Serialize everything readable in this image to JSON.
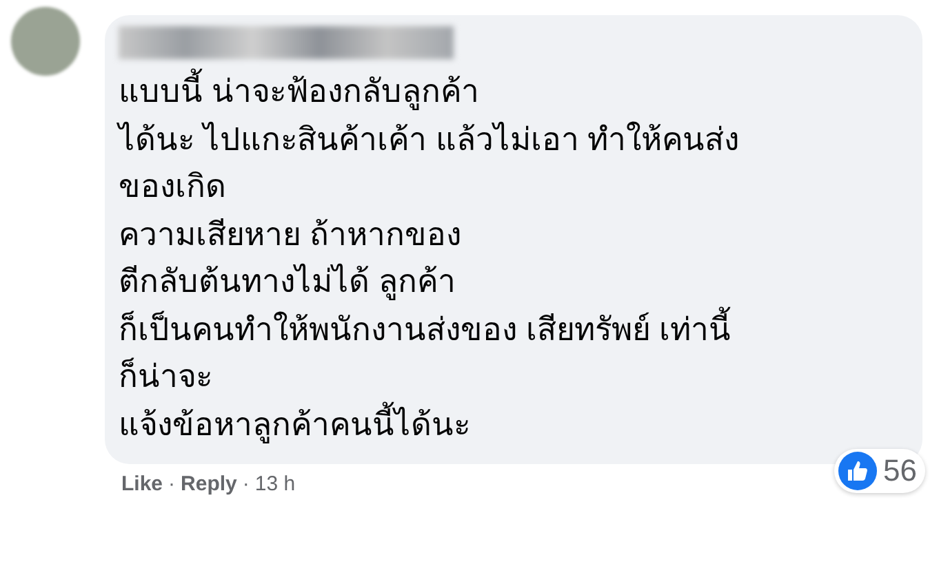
{
  "comment": {
    "lines": [
      "แบบนี้ น่าจะฟ้องกลับลูกค้า",
      "ได้นะ ไปแกะสินค้าเค้า แล้วไม่เอา ทำให้คนส่ง",
      "ของเกิด",
      "ความเสียหาย ถ้าหากของ",
      "ตีกลับต้นทางไม่ได้ ลูกค้า",
      "ก็เป็นคนทำให้พนักงานส่งของ เสียทรัพย์ เท่านี้",
      "ก็น่าจะ",
      "แจ้งข้อหาลูกค้าคนนี้ได้นะ"
    ],
    "reactions": {
      "count": "56"
    }
  },
  "footer": [
    {
      "kind": "like",
      "text": "Like"
    },
    {
      "kind": "separator",
      "text": "·"
    },
    {
      "kind": "reply",
      "text": "Reply"
    },
    {
      "kind": "separator",
      "text": "·"
    },
    {
      "kind": "time",
      "text": "13 h"
    }
  ]
}
